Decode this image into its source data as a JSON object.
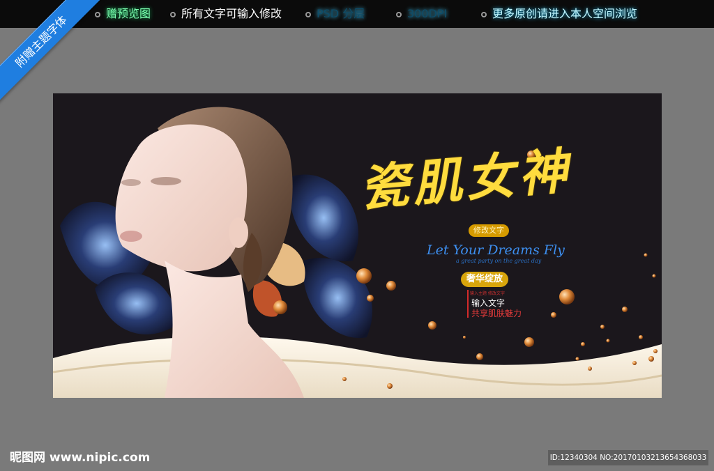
{
  "ribbon": {
    "text": "附赠主题字体"
  },
  "topbar": {
    "items": [
      {
        "label": "赠预览图"
      },
      {
        "label": "所有文字可输入修改"
      },
      {
        "label": "PSD 分层"
      },
      {
        "label": "300DPI"
      },
      {
        "label": "更多原创请进入本人空间浏览"
      }
    ]
  },
  "poster": {
    "title": "瓷肌女神",
    "badge_small": "修改文字",
    "tagline": "Let Your Dreams Fly",
    "tagline_sub": "a great party on the great day",
    "badge_main": "奢华绽放",
    "note_small": "输入主题 修改文字",
    "note_line1": "输入文字",
    "note_line2": "共享肌肤魅力"
  },
  "watermark": {
    "logo": "昵图网 www.nipic.com",
    "id_text": "ID:12340304 NO:20170103213654368033"
  },
  "colors": {
    "background": "#7a7a7a",
    "poster_bg": "#1b171c",
    "title": "#ffdc3e",
    "ribbon": "#1f7ee0"
  }
}
